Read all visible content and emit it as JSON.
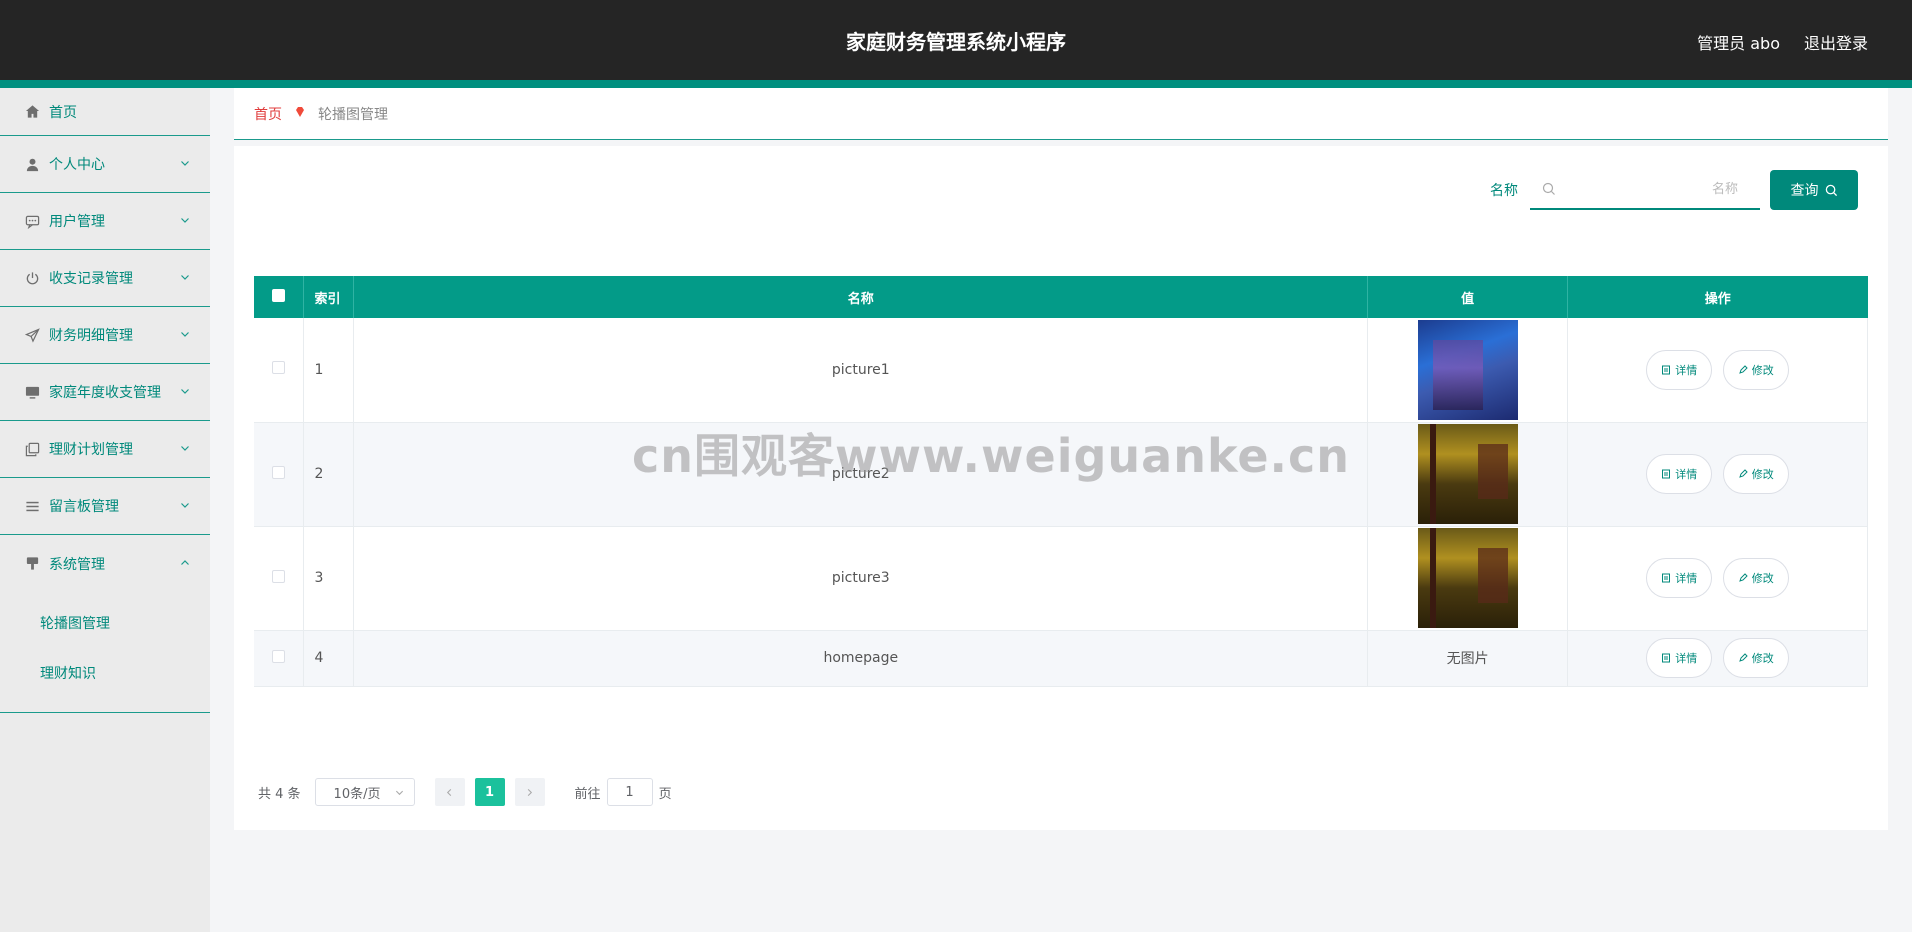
{
  "header": {
    "title": "家庭财务管理系统小程序",
    "user": "管理员 abo",
    "logout": "退出登录"
  },
  "sidebar": {
    "items": [
      {
        "label": "首页",
        "icon": "home-icon"
      },
      {
        "label": "个人中心",
        "icon": "user-icon"
      },
      {
        "label": "用户管理",
        "icon": "chat-icon"
      },
      {
        "label": "收支记录管理",
        "icon": "power-icon"
      },
      {
        "label": "财务明细管理",
        "icon": "send-icon"
      },
      {
        "label": "家庭年度收支管理",
        "icon": "monitor-icon"
      },
      {
        "label": "理财计划管理",
        "icon": "copy-icon"
      },
      {
        "label": "留言板管理",
        "icon": "list-icon"
      },
      {
        "label": "系统管理",
        "icon": "brush-icon"
      }
    ],
    "submenu": [
      {
        "label": "轮播图管理"
      },
      {
        "label": "理财知识"
      }
    ]
  },
  "breadcrumb": {
    "home": "首页",
    "current": "轮播图管理"
  },
  "search": {
    "label": "名称",
    "placeholder": "名称",
    "button": "查询"
  },
  "table": {
    "headers": {
      "index": "索引",
      "name": "名称",
      "value": "值",
      "action": "操作"
    },
    "rows": [
      {
        "index": "1",
        "name": "picture1",
        "value": "image"
      },
      {
        "index": "2",
        "name": "picture2",
        "value": "image"
      },
      {
        "index": "3",
        "name": "picture3",
        "value": "image"
      },
      {
        "index": "4",
        "name": "homepage",
        "value": "无图片"
      }
    ],
    "detail_label": "详情",
    "edit_label": "修改"
  },
  "pagination": {
    "total": "共 4 条",
    "page_size": "10条/页",
    "current_page": "1",
    "goto_prefix": "前往",
    "goto_value": "1",
    "goto_suffix": "页"
  },
  "watermark": "cn围观客www.weiguanke.cn"
}
